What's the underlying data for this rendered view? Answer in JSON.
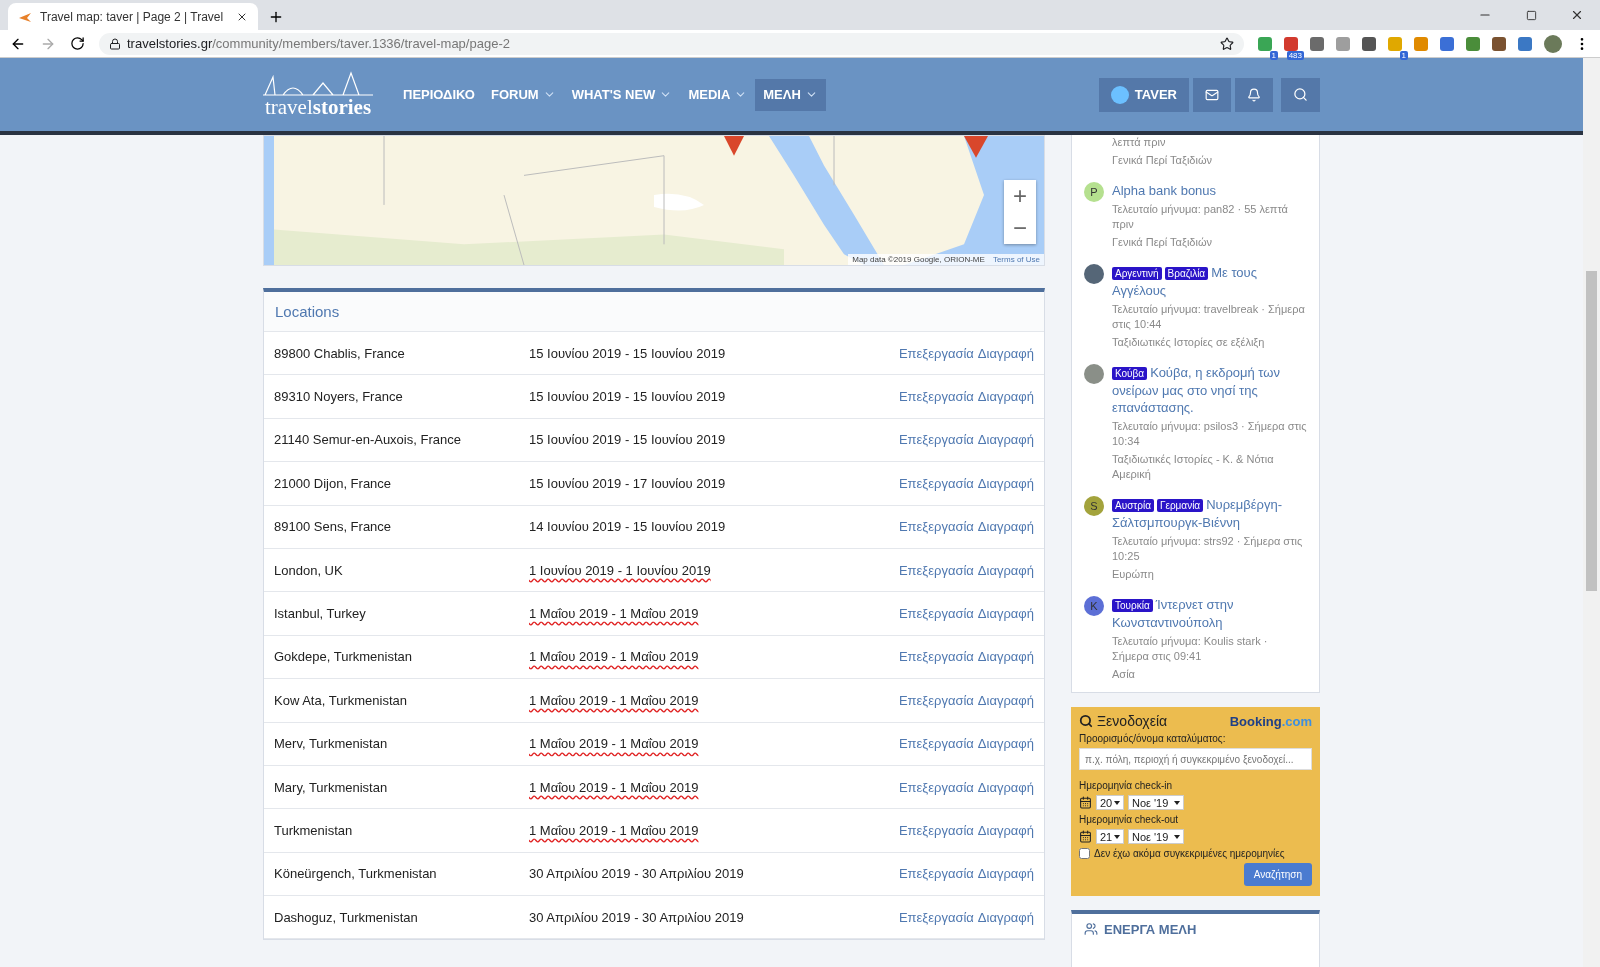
{
  "browser": {
    "tab_title": "Travel map: taver | Page 2 | Travel",
    "url_host": "travelstories.gr",
    "url_path": "/community/members/taver.1336/travel-map/page-2",
    "extensions": [
      {
        "color": "#3aa655",
        "badge": "1"
      },
      {
        "color": "#d23a2e",
        "badge": "483"
      },
      {
        "color": "#6b6b6b"
      },
      {
        "color": "#9e9e9e"
      },
      {
        "color": "#555555"
      },
      {
        "color": "#e0a800",
        "badge": "1"
      },
      {
        "color": "#e08a00"
      },
      {
        "color": "#3b6fd6"
      },
      {
        "color": "#4a8d3a"
      },
      {
        "color": "#7a5230"
      },
      {
        "color": "#3b78c4"
      }
    ]
  },
  "site": {
    "logo": {
      "light": "travel",
      "bold": "stories"
    },
    "nav": [
      {
        "label": "ΠΕΡΙΟΔΙΚΟ",
        "has_menu": false,
        "selected": false
      },
      {
        "label": "FORUM",
        "has_menu": true,
        "selected": false
      },
      {
        "label": "WHAT'S NEW",
        "has_menu": true,
        "selected": false
      },
      {
        "label": "MEDIA",
        "has_menu": true,
        "selected": false
      },
      {
        "label": "ΜΕΛΗ",
        "has_menu": true,
        "selected": true
      }
    ],
    "user": {
      "name": "TAVER"
    }
  },
  "map": {
    "kind": "picture",
    "zoom_in": "+",
    "zoom_out": "−",
    "attribution": "Map data ©2019 Google, ORION-ME",
    "terms": "Terms of Use"
  },
  "locations": {
    "title": "Locations",
    "rows": [
      {
        "place": "89800 Chablis, France",
        "dates": "15 Ιουνίου 2019 - 15 Ιουνίου 2019",
        "edit": "Επεξεργασία",
        "delete": "Διαγραφή",
        "underlined": false
      },
      {
        "place": "89310 Noyers, France",
        "dates": "15 Ιουνίου 2019 - 15 Ιουνίου 2019",
        "edit": "Επεξεργασία",
        "delete": "Διαγραφή",
        "underlined": false
      },
      {
        "place": "21140 Semur-en-Auxois, France",
        "dates": "15 Ιουνίου 2019 - 15 Ιουνίου 2019",
        "edit": "Επεξεργασία",
        "delete": "Διαγραφή",
        "underlined": false
      },
      {
        "place": "21000 Dijon, France",
        "dates": "15 Ιουνίου 2019 - 17 Ιουνίου 2019",
        "edit": "Επεξεργασία",
        "delete": "Διαγραφή",
        "underlined": false
      },
      {
        "place": "89100 Sens, France",
        "dates": "14 Ιουνίου 2019 - 15 Ιουνίου 2019",
        "edit": "Επεξεργασία",
        "delete": "Διαγραφή",
        "underlined": false
      },
      {
        "place": "London, UK",
        "dates": "1 Ιουνίου 2019 - 1 Ιουνίου 2019",
        "edit": "Επεξεργασία",
        "delete": "Διαγραφή",
        "underlined": true
      },
      {
        "place": "Istanbul, Turkey",
        "dates": "1 Μαΐου 2019 - 1 Μαΐου 2019",
        "edit": "Επεξεργασία",
        "delete": "Διαγραφή",
        "underlined": true
      },
      {
        "place": "Gokdepe, Turkmenistan",
        "dates": "1 Μαΐου 2019 - 1 Μαΐου 2019",
        "edit": "Επεξεργασία",
        "delete": "Διαγραφή",
        "underlined": true
      },
      {
        "place": "Kow Ata, Turkmenistan",
        "dates": "1 Μαΐου 2019 - 1 Μαΐου 2019",
        "edit": "Επεξεργασία",
        "delete": "Διαγραφή",
        "underlined": true
      },
      {
        "place": "Merv, Turkmenistan",
        "dates": "1 Μαΐου 2019 - 1 Μαΐου 2019",
        "edit": "Επεξεργασία",
        "delete": "Διαγραφή",
        "underlined": true
      },
      {
        "place": "Mary, Turkmenistan",
        "dates": "1 Μαΐου 2019 - 1 Μαΐου 2019",
        "edit": "Επεξεργασία",
        "delete": "Διαγραφή",
        "underlined": true
      },
      {
        "place": "Turkmenistan",
        "dates": "1 Μαΐου 2019 - 1 Μαΐου 2019",
        "edit": "Επεξεργασία",
        "delete": "Διαγραφή",
        "underlined": true
      },
      {
        "place": "Köneürgench, Turkmenistan",
        "dates": "30 Απριλίου 2019 - 30 Απριλίου 2019",
        "edit": "Επεξεργασία",
        "delete": "Διαγραφή",
        "underlined": false
      },
      {
        "place": "Dashoguz, Turkmenistan",
        "dates": "30 Απριλίου 2019 - 30 Απριλίου 2019",
        "edit": "Επεξεργασία",
        "delete": "Διαγραφή",
        "underlined": false
      }
    ]
  },
  "threads": [
    {
      "kind": "cut",
      "meta": "λεπτά πριν",
      "forum": "Γενικά Περί Ταξιδιών"
    },
    {
      "kind": "letter",
      "letter": "P",
      "color": "#b5e08f",
      "title": "Alpha bank bonus",
      "meta": "Τελευταίο μήνυμα: pan82 · 55 λεπτά πριν",
      "forum": "Γενικά Περί Ταξιδιών"
    },
    {
      "color": "#556677",
      "tags": [
        "Αργεντινή",
        "Βραζιλία"
      ],
      "title": "Με τους Αγγέλους",
      "meta": "Τελευταίο μήνυμα: travelbreak · Σήμερα στις 10:44",
      "forum": "Ταξιδιωτικές Ιστορίες σε εξέλιξη"
    },
    {
      "color": "#8a8f88",
      "tags": [
        "Κούβα"
      ],
      "title": "Κούβα, η εκδρομή των ονείρων μας στο νησί της επανάστασης.",
      "meta": "Τελευταίο μήνυμα: psilos3 · Σήμερα στις 10:34",
      "forum": "Ταξιδιωτικές Ιστορίες - Κ. & Νότια Αμερική"
    },
    {
      "kind": "letter",
      "letter": "S",
      "color": "#a3a33c",
      "tags": [
        "Αυστρία",
        "Γερμανία"
      ],
      "title": "Νυρεμβέργη-Σάλτσμπουργκ-Βιέννη",
      "meta": "Τελευταίο μήνυμα: strs92 · Σήμερα στις 10:25",
      "forum": "Ευρώπη"
    },
    {
      "kind": "letter",
      "letter": "K",
      "color": "#5c6fd6",
      "tags": [
        "Τουρκία"
      ],
      "title": "Ίντερνετ στην Κωνσταντινούπολη",
      "meta": "Τελευταίο μήνυμα: Koulis stark · Σήμερα στις 09:41",
      "forum": "Ασία"
    }
  ],
  "booking": {
    "title": "Ξενοδοχεία",
    "brand": "Booking",
    "brand_suffix": ".com",
    "destination_label": "Προορισμός/όνομα καταλύματος:",
    "placeholder": "π.χ. πόλη, περιοχή ή συγκεκριμένο ξενοδοχεί...",
    "checkin": {
      "label": "Ημερομηνία check-in",
      "day": "20",
      "month": "Νοε '19"
    },
    "checkout": {
      "label": "Ημερομηνία check-out",
      "day": "21",
      "month": "Νοε '19"
    },
    "no_dates": {
      "label": "Δεν έχω ακόμα συγκεκριμένες ημερομηνίες",
      "checked": false
    },
    "button": "Αναζήτηση"
  },
  "active_members": {
    "title": "ΕΝΕΡΓΑ ΜΕΛΗ"
  }
}
